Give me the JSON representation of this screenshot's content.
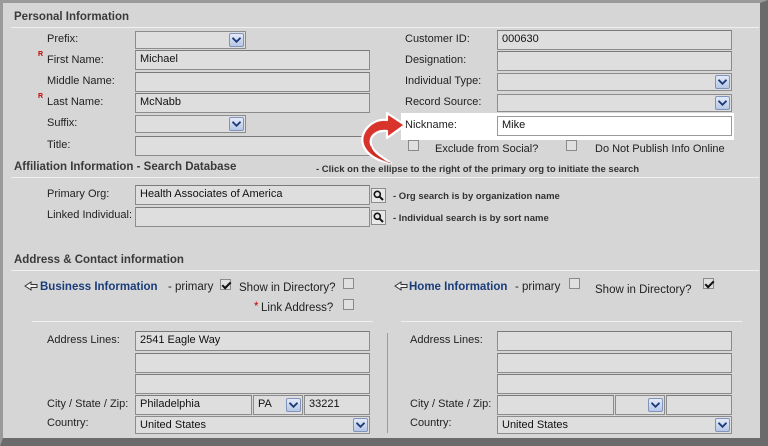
{
  "personal": {
    "section_title": "Personal Information",
    "prefix_label": "Prefix:",
    "first_name_label": "First Name:",
    "first_name_value": "Michael",
    "middle_name_label": "Middle Name:",
    "middle_name_value": "",
    "last_name_label": "Last Name:",
    "last_name_value": "McNabb",
    "suffix_label": "Suffix:",
    "title_label": "Title:",
    "title_value": "",
    "required_marker": "R",
    "customer_id_label": "Customer ID:",
    "customer_id_value": "000630",
    "designation_label": "Designation:",
    "designation_value": "",
    "individual_type_label": "Individual Type:",
    "record_source_label": "Record Source:",
    "nickname_label": "Nickname:",
    "nickname_value": "Mike",
    "exclude_social_label": "Exclude from Social?",
    "do_not_publish_label": "Do Not Publish Info Online"
  },
  "affiliation": {
    "section_title": "Affiliation Information - Search Database",
    "hint": "- Click on the ellipse to the right of the primary org to initiate the search",
    "primary_org_label": "Primary Org:",
    "primary_org_value": "Health Associates of America",
    "primary_org_note": "- Org search is by organization name",
    "linked_individual_label": "Linked Individual:",
    "linked_individual_value": "",
    "linked_individual_note": "- Individual search is by sort name"
  },
  "address": {
    "section_title": "Address & Contact information",
    "business": {
      "title": "Business Information",
      "primary_label": "- primary",
      "primary_checked": true,
      "show_directory_label": "Show in Directory?",
      "show_directory_checked": false,
      "link_address_marker": "*",
      "link_address_label": "Link Address?",
      "address_lines_label": "Address Lines:",
      "address_line1": "2541 Eagle Way",
      "address_line2": "",
      "address_line3": "",
      "city_state_zip_label": "City / State / Zip:",
      "city": "Philadelphia",
      "state": "PA",
      "zip": "33221",
      "country_label": "Country:",
      "country": "United States"
    },
    "home": {
      "title": "Home Information",
      "primary_label": "- primary",
      "primary_checked": false,
      "show_directory_label": "Show in Directory?",
      "show_directory_checked": true,
      "address_lines_label": "Address Lines:",
      "address_line1": "",
      "address_line2": "",
      "address_line3": "",
      "city_state_zip_label": "City / State / Zip:",
      "city": "",
      "state": "",
      "zip": "",
      "country_label": "Country:",
      "country": "United States"
    }
  },
  "icons": {
    "dropdown": "chevron-down-icon",
    "lookup": "magnifier-icon",
    "collapse": "collapse-arrow-icon",
    "callout": "curved-arrow-icon"
  },
  "colors": {
    "background": "#d6d6d6",
    "link_blue": "#1a3d7a",
    "required_red": "#c00000",
    "callout_red": "#d9342b"
  }
}
